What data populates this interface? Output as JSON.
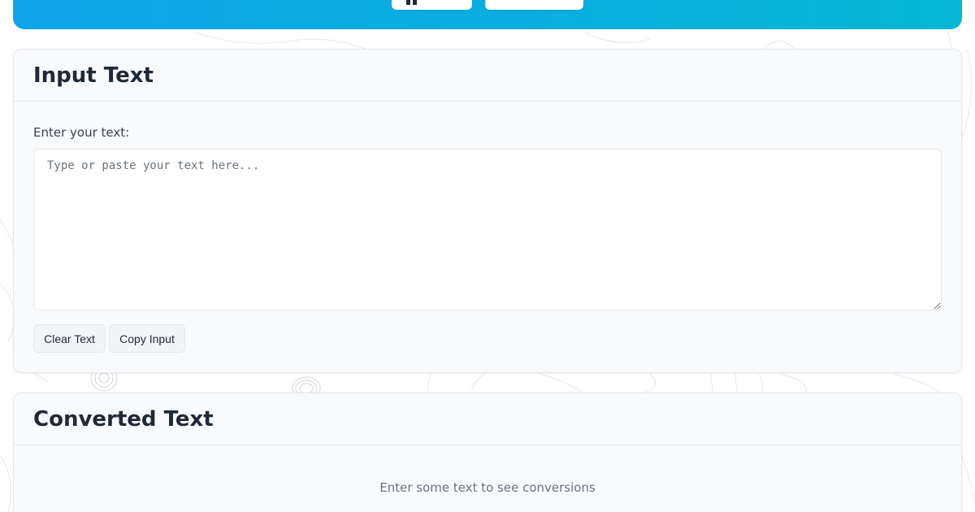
{
  "input_section": {
    "title": "Input Text",
    "field_label": "Enter your text:",
    "textarea_value": "",
    "textarea_placeholder": "Type or paste your text here...",
    "clear_button_label": "Clear Text",
    "copy_button_label": "Copy Input"
  },
  "output_section": {
    "title": "Converted Text",
    "empty_message": "Enter some text to see conversions"
  },
  "colors": {
    "header_gradient_start": "#0ea5e9",
    "header_gradient_end": "#06b6d4",
    "card_background": "#f9fafb",
    "border": "#e5e7eb",
    "text_primary": "#1f2937",
    "text_muted": "#6b7280"
  }
}
